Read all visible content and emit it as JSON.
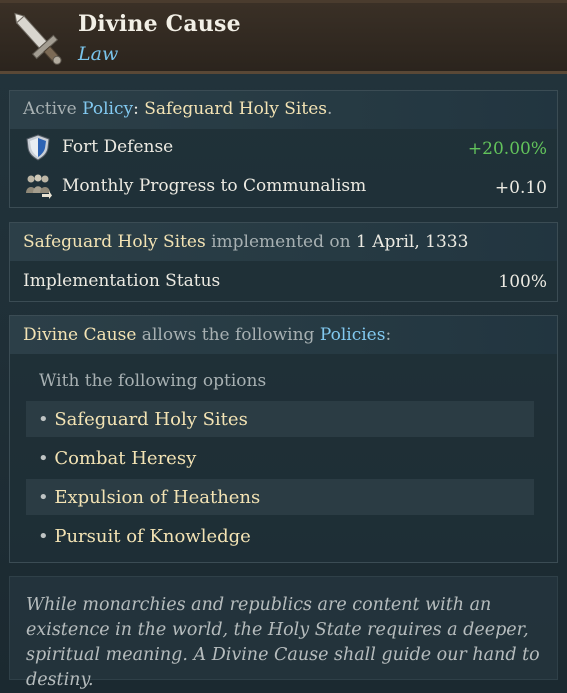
{
  "header": {
    "title": "Divine Cause",
    "subtitle": "Law",
    "icon": "sword-icon"
  },
  "active_policy": {
    "prefix": "Active",
    "policy_word": "Policy",
    "colon": ": ",
    "name": "Safeguard Holy Sites",
    "suffix": ".",
    "effects": [
      {
        "icon": "shield-icon",
        "label": "Fort Defense",
        "value": "+20.00%",
        "color": "#62c35b"
      },
      {
        "icon": "people-icon",
        "label": "Monthly Progress to Communalism",
        "value": "+0.10",
        "color": "#eceae2"
      }
    ]
  },
  "implementation": {
    "policy": "Safeguard Holy Sites",
    "middle": " implemented on ",
    "date": "1 April, 1333",
    "status_label": "Implementation Status",
    "status_value": "100%"
  },
  "allows": {
    "law": "Divine Cause",
    "middle": " allows the following ",
    "policies_word": "Policies",
    "colon": ":",
    "options_heading": "With the following options",
    "options": [
      "Safeguard Holy Sites",
      "Combat Heresy",
      "Expulsion of Heathens",
      "Pursuit of Knowledge"
    ]
  },
  "flavor_text": "While monarchies and republics are content with an existence in the world, the Holy State requires a deeper, spiritual meaning. A Divine Cause shall guide our hand to destiny."
}
